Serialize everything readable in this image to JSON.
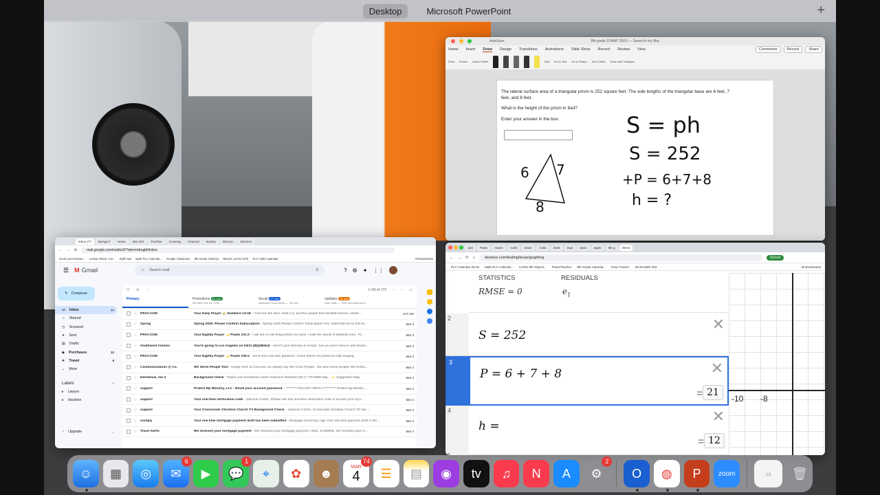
{
  "spaces": {
    "items": [
      "Desktop",
      "Microsoft PowerPoint"
    ],
    "active": 0
  },
  "powerpoint": {
    "title": "8th grade STAAR TEKS — Saved to my Mac",
    "autosave": "AutoSave",
    "menu": [
      "Home",
      "Insert",
      "Draw",
      "Design",
      "Transitions",
      "Animations",
      "Slide Show",
      "Record",
      "Review",
      "View"
    ],
    "active_menu": "Draw",
    "buttons": {
      "comments": "Comments",
      "record": "Record",
      "share": "Share"
    },
    "ribbon": {
      "draw": "Draw",
      "eraser": "Eraser",
      "lasso": "Lasso Select",
      "add": "Add",
      "ink_to_text": "Ink to Text",
      "ink_to_shape": "Ink to Shape",
      "ink_to_math": "Ink to Math",
      "draw_trackpad": "Draw with Trackpad"
    },
    "question": {
      "line1": "The lateral surface area of a triangular prism is 252 square feet. The side lengths of the triangular base are 6 feet, 7",
      "line2": "feet, and 8 feet.",
      "line3": "What is the height of the prism in feet?",
      "line4": "Enter your answer in the box."
    },
    "ink": {
      "eq1": "S = ph",
      "eq2": "S = 252",
      "eq3": "+P = 6+7+8",
      "eq4": "h = ?",
      "tri_left": "6",
      "tri_right": "7",
      "tri_bottom": "8"
    }
  },
  "desmos": {
    "tabs": [
      "Upli",
      "Powe",
      "Aware",
      "Corbi",
      "Searc",
      "Colla",
      "2025",
      "lead",
      "Sprin",
      "algeb",
      "8th g",
      "Desm"
    ],
    "url": "desmos.com/testing/texas/graphing",
    "profile": "School",
    "bookmarks": [
      "PLC Calendar 25-26",
      "Math PLC Calenda...",
      "Corbin 8th Objecti...",
      "PowerTeacher",
      "8th Grade Calenda...",
      "Pass Tracker",
      "25-26 Math Test",
      "All Bookmarks"
    ],
    "statistics_label": "STATISTICS",
    "residuals_label": "RESIDUALS",
    "rmse": "RMSE = 0",
    "residual_var": "e",
    "residual_sub": "1",
    "expressions": [
      {
        "index": "2",
        "latex": "S = 252",
        "result": ""
      },
      {
        "index": "3",
        "latex": "P = 6 + 7 + 8",
        "result": "21"
      },
      {
        "index": "4",
        "latex": "h =",
        "result": "12"
      },
      {
        "index": "5",
        "latex": "",
        "result": ""
      }
    ],
    "graph_ticks": [
      "-10",
      "-8"
    ]
  },
  "gmail": {
    "tabs": [
      "Inbox (77",
      "MyApp F",
      "Home",
      "Mar 202",
      "Purchas",
      "Coverag",
      "Channel",
      "lead4w",
      "Microso",
      "Desmos"
    ],
    "url": "mail.google.com/mail/u/0/?tab=rm&ogbl#inbox",
    "bookmarks": [
      "24-25 ULS Resour...",
      "Lesson Plans- Cor...",
      "Staff mail",
      "Math PLC Calenda...",
      "Google Classroom",
      "8th Grade Advisory",
      "NELDC LOAN SITE",
      "PLC CMO Calendar",
      "All Bookmarks"
    ],
    "logo": "Gmail",
    "search_placeholder": "Search mail",
    "compose": "Compose",
    "nav": [
      {
        "label": "Inbox",
        "count": "77"
      },
      {
        "label": "Starred",
        "count": ""
      },
      {
        "label": "Snoozed",
        "count": ""
      },
      {
        "label": "Sent",
        "count": ""
      },
      {
        "label": "Drafts",
        "count": ""
      },
      {
        "label": "Purchases",
        "count": "12"
      },
      {
        "label": "Travel",
        "count": "6"
      },
      {
        "label": "More",
        "count": ""
      }
    ],
    "labels_title": "Labels",
    "labels": [
      "Lawyer",
      "Vacation"
    ],
    "upgrade": "Upgrade",
    "pagination": "1–50 of 173",
    "categories": [
      {
        "label": "Primary",
        "badge": "",
        "sub": ""
      },
      {
        "label": "Promotions",
        "badge": "50 new",
        "sub": "We offer free for 2705..."
      },
      {
        "label": "Social",
        "badge": "37 new",
        "sub": "Nextdoor Local News — Top sto..."
      },
      {
        "label": "Updates",
        "badge": "14 new",
        "sub": "Uber Safe — Your next takeout w..."
      }
    ],
    "emails": [
      {
        "from": "PRAY.COM",
        "subject": "Your Daily Prayer 🙏 Numbers 13:18",
        "snippet": " - \"And see the land, what it is, and the people that dwelleth therein, wheth...",
        "date": "4:27 AM"
      },
      {
        "from": "Spring",
        "subject": "Spring 2026: Please Confirm Subscription",
        "snippet": " - Spring 2026 Please Confirm Subscription Yes, subscribe me to this lis...",
        "date": "Mar 3"
      },
      {
        "from": "PRAY.COM",
        "subject": "Your Nightly Prayer 🌙 Psalm 101:3",
        "snippet": " - I will set no vile thing before my eyes. I hate the deeds of faithless men. Th...",
        "date": "Mar 3"
      },
      {
        "from": "Southwest Airlines",
        "subject": "You're going to Los Angeles on 03/11 (BQUB4U)!",
        "snippet": " - Here's your itinerary & receipt. See ya soon! View in web brows...",
        "date": "Mar 3"
      },
      {
        "from": "PRAY.COM",
        "subject": "Your Nightly Prayer 🌙 Psalm 100:2",
        "snippet": " - Serve the Lord with gladness. Come before his presence with singing.",
        "date": "Mar 2"
      },
      {
        "from": "Communications @ Co.",
        "subject": "We Serve People Too!",
        "snippet": " - Image Here at Concord, we always say We Grow People.. We also serve people! We believ...",
        "date": "Mar 2"
      },
      {
        "from": "Demetrius, me 3",
        "subject": "Background Check",
        "snippet": " - Thank you! Demetrius Carter Outreach Resident (817) 779-5999 http... ✨ Suggested reply",
        "date": "Mar 2"
      },
      {
        "from": "support",
        "subject": "Protect My Ministry, LLC - Reset your account password.",
        "snippet": " - **********DO NOT REPLY********** Protect My Ministr...",
        "date": "Mar 2"
      },
      {
        "from": "support",
        "subject": "Your one-time verification code",
        "snippet": " - Jasmine Corbin, Please use this one-time verification code to access your myA...",
        "date": "Mar 2"
      },
      {
        "from": "support",
        "subject": "Your Crossroads Christian Church TX Background Check.",
        "snippet": " - Jasmine Corbin, Crossroads Christian Church TX has ...",
        "date": "Mar 2"
      },
      {
        "from": "noreply",
        "subject": "Your one time mortgage payment draft has been submitted",
        "snippet": " - Mortgage Servicing Logo Your one time payment draft in the ...",
        "date": "Mar 2"
      },
      {
        "from": "Truist Alerts",
        "subject": "We received your mortgage payment",
        "snippet": " - We received your mortgage payment. Hello, JASMINE, We received your m...",
        "date": "Mar 2"
      }
    ]
  },
  "dock": {
    "calendar_month": "MAR",
    "calendar_day": "4",
    "badges": {
      "mail": "6",
      "messages": "1",
      "calendar": "74",
      "settings": "2"
    },
    "zoom_label": "zoom"
  }
}
